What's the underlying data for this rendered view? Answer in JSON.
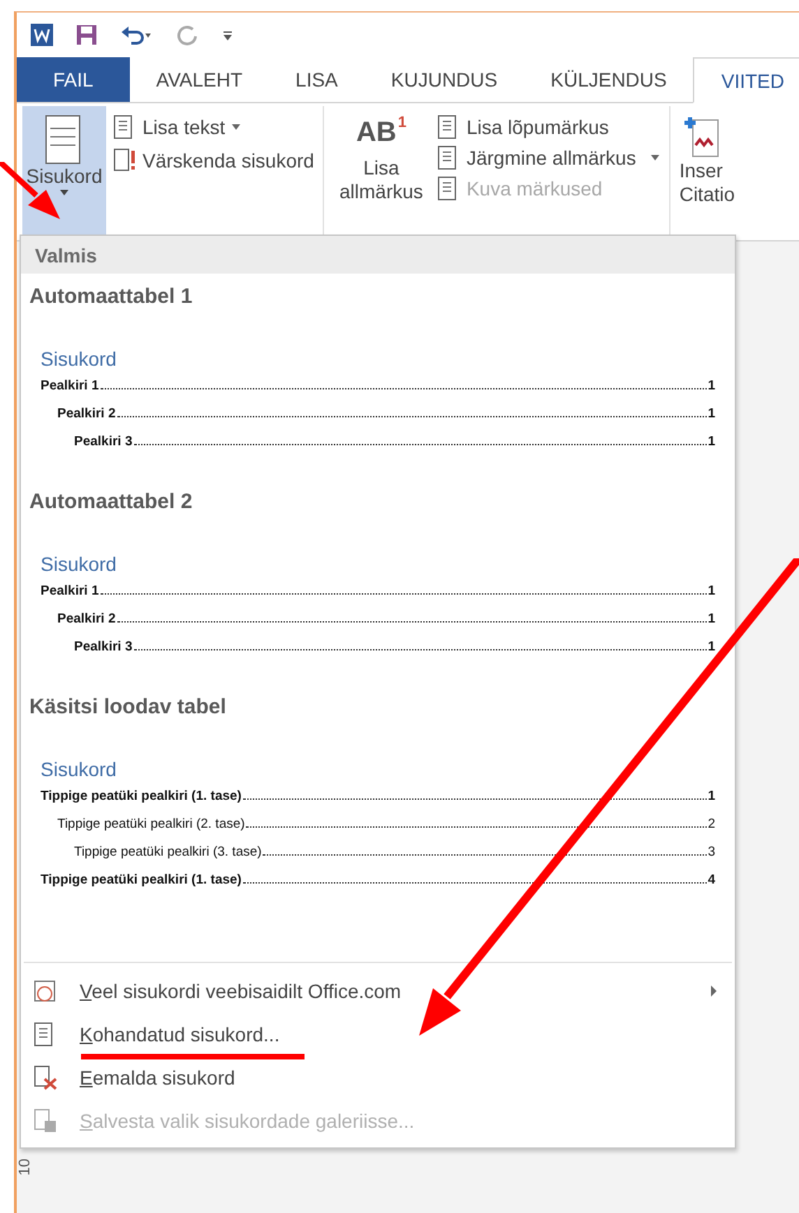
{
  "tabs": [
    {
      "label": "FAIL",
      "kind": "file",
      "selected": false
    },
    {
      "label": "AVALEHT",
      "kind": "tab",
      "selected": false
    },
    {
      "label": "LISA",
      "kind": "tab",
      "selected": false
    },
    {
      "label": "KUJUNDUS",
      "kind": "tab",
      "selected": false
    },
    {
      "label": "KÜLJENDUS",
      "kind": "tab",
      "selected": false
    },
    {
      "label": "VIITED",
      "kind": "tab",
      "selected": true
    }
  ],
  "ribbon": {
    "toc_button": {
      "label": "Sisukord",
      "pressed": true
    },
    "toc_commands": [
      {
        "label": "Lisa tekst",
        "dropdown": true,
        "disabled": false
      },
      {
        "label": "Värskenda sisukord",
        "dropdown": false,
        "disabled": false
      }
    ],
    "footnote_button": {
      "icon_text": "AB",
      "icon_superscript": "1",
      "label_lines": [
        "Lisa",
        "allmärkus"
      ]
    },
    "footnote_commands": [
      {
        "label": "Lisa lõpumärkus",
        "dropdown": false,
        "disabled": false
      },
      {
        "label": "Järgmine allmärkus",
        "dropdown": true,
        "disabled": false
      },
      {
        "label": "Kuva märkused",
        "dropdown": false,
        "disabled": true
      }
    ],
    "citation_button": {
      "label_lines": [
        "Inser",
        "Citatio"
      ]
    }
  },
  "gallery": {
    "header": "Valmis",
    "sections": [
      {
        "title": "Automaattabel 1",
        "toc_title": "Sisukord",
        "entries": [
          {
            "text": "Pealkiri 1",
            "page": "1",
            "bold": true,
            "children": [
              {
                "text": "Pealkiri 2",
                "page": "1",
                "bold": true,
                "children": [
                  {
                    "text": "Pealkiri 3",
                    "page": "1",
                    "bold": true
                  }
                ]
              }
            ]
          }
        ]
      },
      {
        "title": "Automaattabel 2",
        "toc_title": "Sisukord",
        "entries": [
          {
            "text": "Pealkiri 1",
            "page": "1",
            "bold": true,
            "children": [
              {
                "text": "Pealkiri 2",
                "page": "1",
                "bold": true,
                "children": [
                  {
                    "text": "Pealkiri 3",
                    "page": "1",
                    "bold": true
                  }
                ]
              }
            ]
          }
        ]
      },
      {
        "title": "Käsitsi loodav tabel",
        "toc_title": "Sisukord",
        "entries": [
          {
            "text": "Tippige peatüki pealkiri (1. tase)",
            "page": "1",
            "bold": true,
            "children": [
              {
                "text": "Tippige peatüki pealkiri (2. tase)",
                "page": "2",
                "bold": false,
                "children": [
                  {
                    "text": "Tippige peatüki pealkiri (3. tase)",
                    "page": "3",
                    "bold": false
                  }
                ]
              }
            ]
          },
          {
            "text": "Tippige peatüki pealkiri (1. tase)",
            "page": "4",
            "bold": true
          }
        ]
      }
    ]
  },
  "menu_items": [
    {
      "label": "Veel sisukordi veebisaidilt Office.com",
      "kind": "web",
      "submenu": true,
      "disabled": false
    },
    {
      "label": "Kohandatud sisukord...",
      "kind": "custom",
      "submenu": false,
      "disabled": false
    },
    {
      "label": "Eemalda sisukord",
      "kind": "remove",
      "submenu": false,
      "disabled": false
    },
    {
      "label": "Salvesta valik sisukordade galeriisse...",
      "kind": "save",
      "submenu": false,
      "disabled": true
    }
  ],
  "ruler": {
    "label": "10"
  }
}
